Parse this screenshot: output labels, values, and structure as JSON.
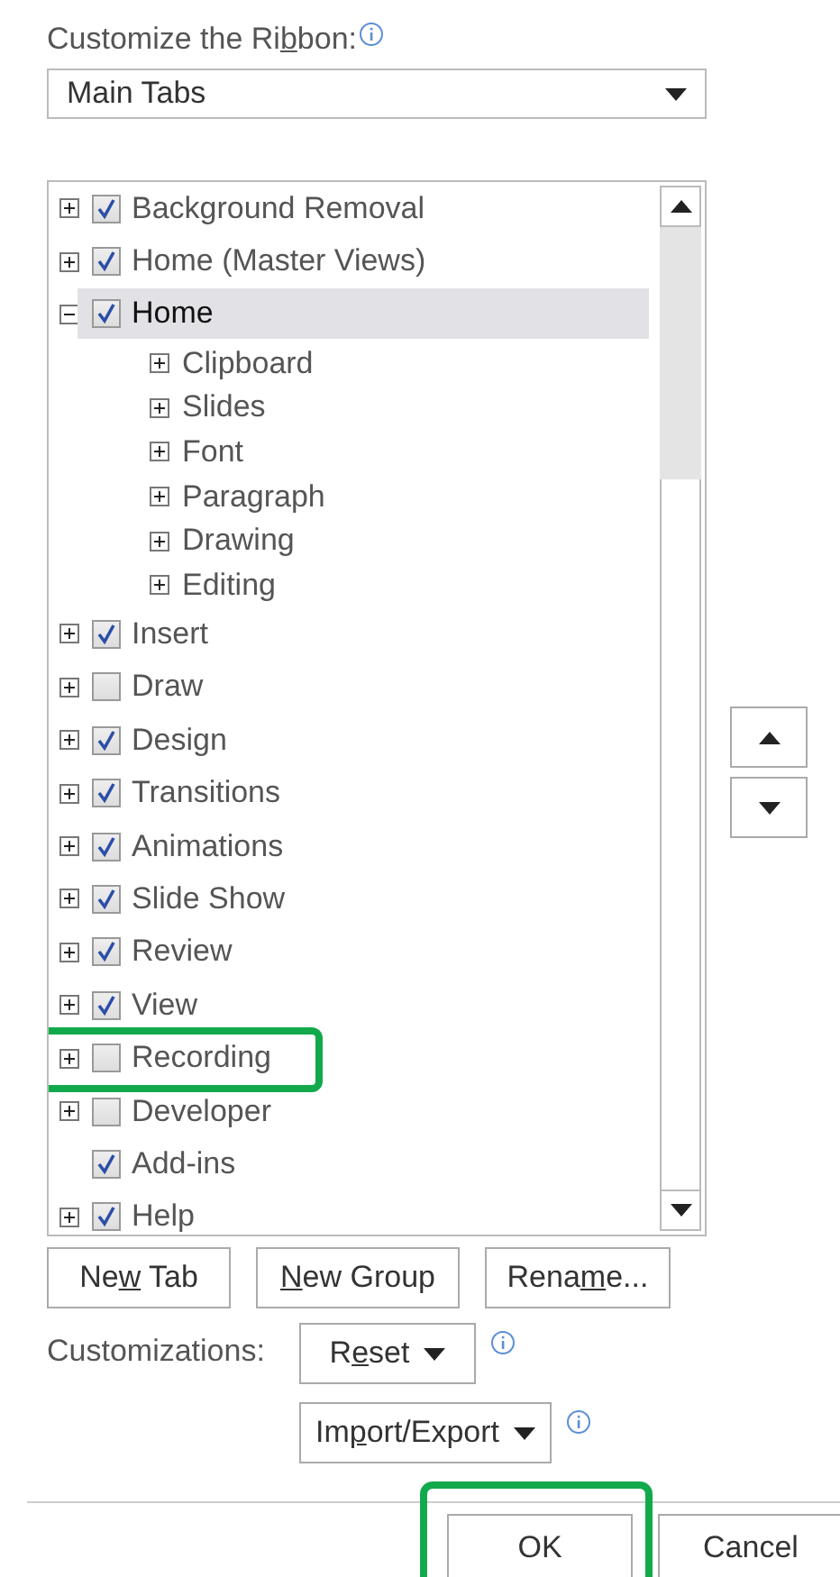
{
  "ribbon_label": {
    "pre": "Customize the Ri",
    "key": "b",
    "post": "bon:"
  },
  "tabs_dropdown": {
    "value": "Main Tabs"
  },
  "tree": [
    {
      "label": "Background Removal",
      "checked": true,
      "expanded": false,
      "selected": false,
      "highlighted": false
    },
    {
      "label": "Home (Master Views)",
      "checked": true,
      "expanded": false,
      "selected": false,
      "highlighted": false
    },
    {
      "label": "Home",
      "checked": true,
      "expanded": true,
      "selected": true,
      "highlighted": false,
      "children": [
        {
          "label": "Clipboard",
          "expanded": false,
          "selected": false
        },
        {
          "label": "Slides",
          "expanded": false,
          "selected": false
        },
        {
          "label": "Font",
          "expanded": false,
          "selected": false
        },
        {
          "label": "Paragraph",
          "expanded": false,
          "selected": false
        },
        {
          "label": "Drawing",
          "expanded": false,
          "selected": false
        },
        {
          "label": "Editing",
          "expanded": false,
          "selected": false
        }
      ]
    },
    {
      "label": "Insert",
      "checked": true,
      "expanded": false,
      "selected": false,
      "highlighted": false
    },
    {
      "label": "Draw",
      "checked": false,
      "expanded": false,
      "selected": false,
      "highlighted": false
    },
    {
      "label": "Design",
      "checked": true,
      "expanded": false,
      "selected": false,
      "highlighted": false
    },
    {
      "label": "Transitions",
      "checked": true,
      "expanded": false,
      "selected": false,
      "highlighted": false
    },
    {
      "label": "Animations",
      "checked": true,
      "expanded": false,
      "selected": false,
      "highlighted": false
    },
    {
      "label": "Slide Show",
      "checked": true,
      "expanded": false,
      "selected": false,
      "highlighted": false
    },
    {
      "label": "Review",
      "checked": true,
      "expanded": false,
      "selected": false,
      "highlighted": false
    },
    {
      "label": "View",
      "checked": true,
      "expanded": false,
      "selected": false,
      "highlighted": false
    },
    {
      "label": "Recording",
      "checked": false,
      "expanded": false,
      "selected": false,
      "highlighted": true
    },
    {
      "label": "Developer",
      "checked": false,
      "expanded": false,
      "selected": false,
      "highlighted": false
    },
    {
      "label": "Add-ins",
      "checked": true,
      "selected": false,
      "highlighted": false
    },
    {
      "label": "Help",
      "checked": true,
      "expanded": false,
      "selected": false,
      "highlighted": false
    }
  ],
  "tree_buttons": [
    {
      "pre": "Ne",
      "key": "w",
      "post": " Tab"
    },
    {
      "key": "N",
      "post": "ew Group"
    },
    {
      "pre": "Rena",
      "key": "m",
      "post": "e..."
    }
  ],
  "customizations": {
    "label": "Customizations:",
    "reset": {
      "pre": "R",
      "key": "e",
      "post": "set"
    },
    "import_export": {
      "pre": "Im",
      "key": "p",
      "post": "ort/Export"
    }
  },
  "dialog_buttons": [
    {
      "label": "OK",
      "highlighted": true
    },
    {
      "label": "Cancel",
      "highlighted": false
    }
  ]
}
